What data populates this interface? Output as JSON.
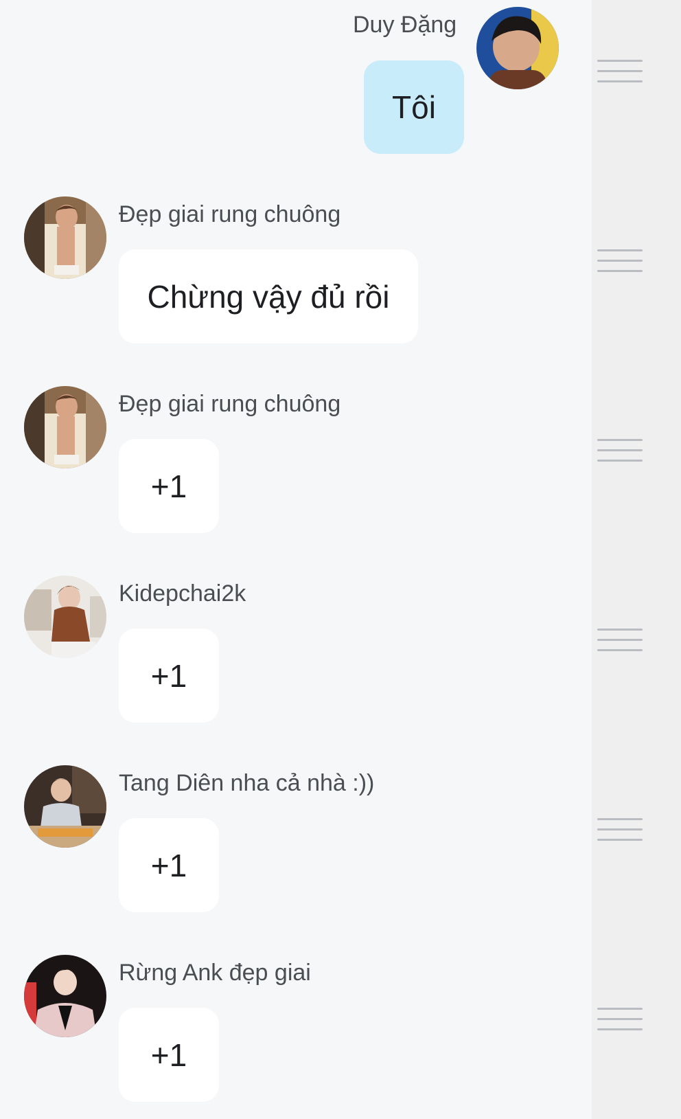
{
  "messages": [
    {
      "sender": "Duy Đặng",
      "text": "Tôi",
      "own": true
    },
    {
      "sender": "Đẹp giai rung chuông",
      "text": "Chừng vậy đủ rồi",
      "own": false
    },
    {
      "sender": "Đẹp giai rung chuông",
      "text": "+1",
      "own": false
    },
    {
      "sender": "Kidepchai2k",
      "text": "+1",
      "own": false
    },
    {
      "sender": "Tang Diên nha cả nhà :))",
      "text": "+1",
      "own": false
    },
    {
      "sender": "Rừng Ank đẹp giai",
      "text": "+1",
      "own": false
    }
  ],
  "icons": {
    "drag_handle": "drag-handle-icon",
    "avatar": "avatar"
  },
  "colors": {
    "background": "#f6f7f9",
    "rail": "#efeff0",
    "own_bubble": "#c9ecfb",
    "other_bubble": "#ffffff",
    "sender_name": "#4a4d52",
    "message_text": "#1d1f22"
  }
}
